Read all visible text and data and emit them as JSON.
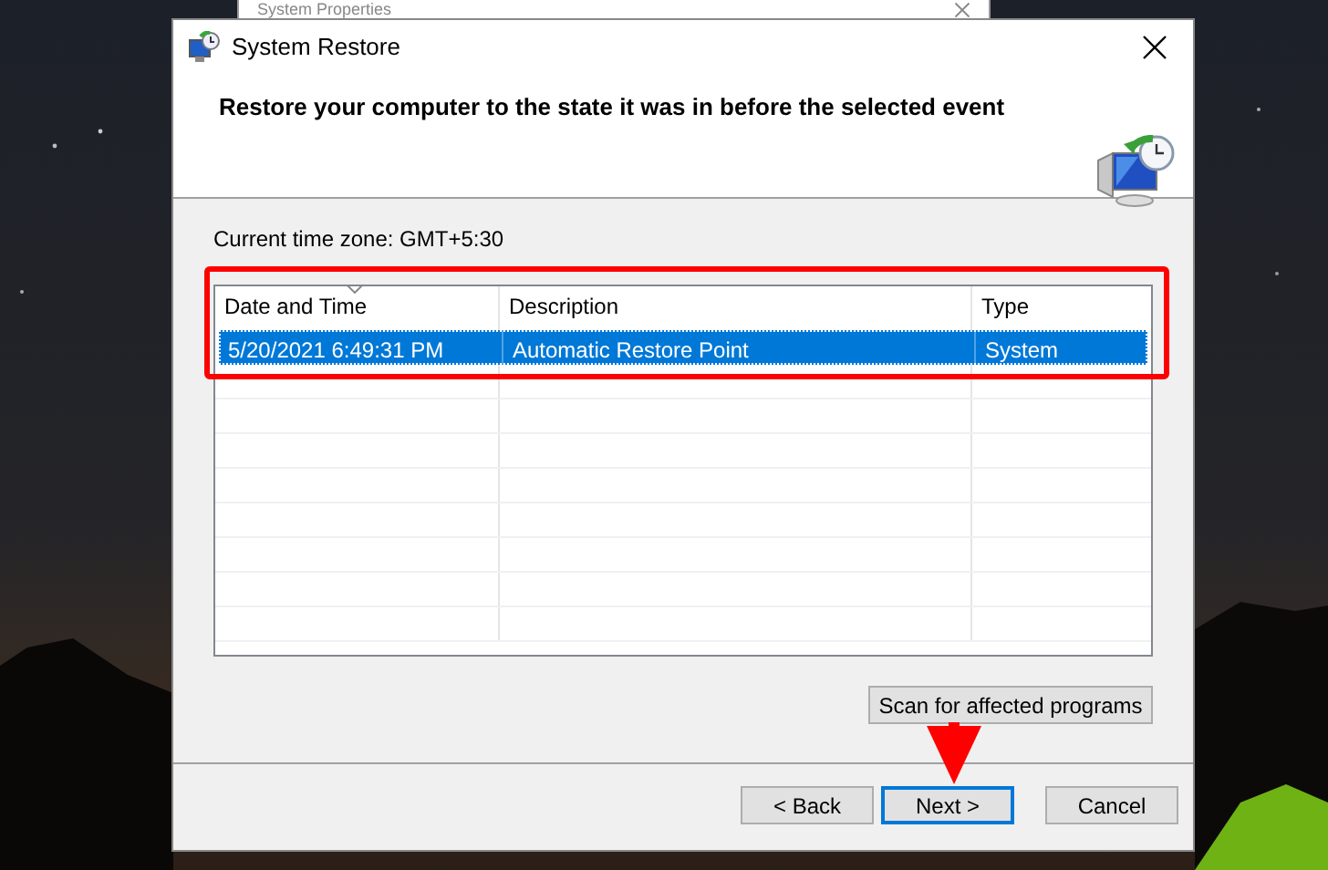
{
  "background_window": {
    "title": "System Properties"
  },
  "dialog": {
    "title": "System Restore",
    "heading": "Restore your computer to the state it was in before the selected event",
    "timezone": "Current time zone: GMT+5:30",
    "table": {
      "columns": [
        {
          "label": "Date and Time",
          "sorted": true
        },
        {
          "label": "Description",
          "sorted": false
        },
        {
          "label": "Type",
          "sorted": false
        }
      ],
      "rows": [
        {
          "cells": [
            "5/20/2021 6:49:31 PM",
            "Automatic Restore Point",
            "System"
          ],
          "selected": true
        }
      ]
    },
    "scan_button": "Scan for affected programs",
    "buttons": [
      {
        "label": "< Back",
        "focused": false
      },
      {
        "label": "Next >",
        "focused": true
      },
      {
        "label": "Cancel",
        "focused": false
      }
    ]
  },
  "annotations": {
    "highlight_frame": true,
    "arrow": true
  }
}
